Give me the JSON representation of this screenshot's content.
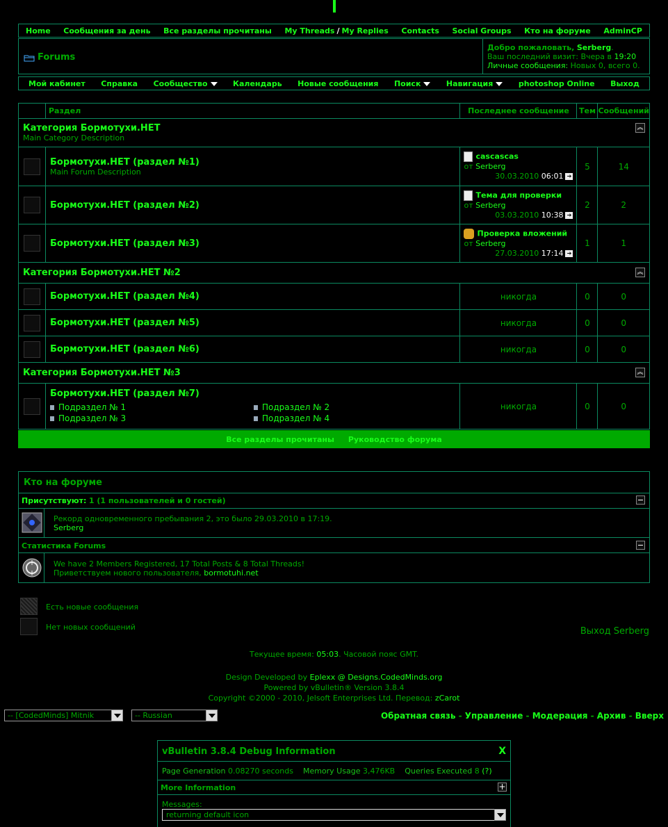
{
  "nav_top": {
    "home": "Home",
    "posts_today": "Сообщения за день",
    "mark_read": "Все разделы прочитаны",
    "my_threads": "My Threads",
    "slash": "/",
    "my_replies": "My Replies",
    "contacts": "Contacts",
    "social_groups": "Social Groups",
    "whos_online": "Кто на форуме",
    "admincp": "AdminCP"
  },
  "header": {
    "title": "Forums",
    "welcome": "Добро пожаловать,",
    "username": "Serberg",
    "period": ".",
    "last_visit_label": "Ваш последний визит:",
    "last_visit_value": "Вчера в",
    "last_visit_time": "19:20",
    "pm_label": "Личные сообщения:",
    "pm_value": "Новых 0, всего 0."
  },
  "nav_bottom": {
    "usercp": "Мой кабинет",
    "help": "Справка",
    "community": "Сообщество",
    "calendar": "Календарь",
    "new_posts": "Новые сообщения",
    "search": "Поиск",
    "navigation": "Навигация",
    "photoshop": "photoshop Online",
    "logout": "Выход"
  },
  "forum_table": {
    "col_forum": "Раздел",
    "col_last": "Последнее сообщение",
    "col_threads": "Тем",
    "col_posts": "Сообщений",
    "from": "от",
    "never": "никогда",
    "categories": [
      {
        "title": "Категория Бормотухи.НЕТ",
        "desc": "Main Category Description",
        "forums": [
          {
            "name": "Бормотухи.НЕТ (раздел №1)",
            "desc": "Main Forum Description",
            "last_title": "cascascas",
            "last_user": "Serberg",
            "last_date": "30.03.2010",
            "last_time": "06:01",
            "threads": "5",
            "posts": "14"
          },
          {
            "name": "Бормотухи.НЕТ (раздел №2)",
            "desc": "",
            "last_title": "Тема для проверки",
            "last_user": "Serberg",
            "last_date": "03.03.2010",
            "last_time": "10:38",
            "threads": "2",
            "posts": "2"
          },
          {
            "name": "Бормотухи.НЕТ (раздел №3)",
            "desc": "",
            "last_title": "Проверка вложений",
            "last_user": "Serberg",
            "last_date": "27.03.2010",
            "last_time": "17:14",
            "threads": "1",
            "posts": "1"
          }
        ]
      },
      {
        "title": "Категория Бормотухи.НЕТ №2",
        "forums": [
          {
            "name": "Бормотухи.НЕТ (раздел №4)",
            "threads": "0",
            "posts": "0"
          },
          {
            "name": "Бормотухи.НЕТ (раздел №5)",
            "threads": "0",
            "posts": "0"
          },
          {
            "name": "Бормотухи.НЕТ (раздел №6)",
            "threads": "0",
            "posts": "0"
          }
        ]
      },
      {
        "title": "Категория Бормотухи.НЕТ №3",
        "forums": [
          {
            "name": "Бормотухи.НЕТ (раздел №7)",
            "threads": "0",
            "posts": "0",
            "subforums": [
              "Подраздел № 1",
              "Подраздел № 2",
              "Подраздел № 3",
              "Подраздел № 4"
            ]
          }
        ]
      }
    ],
    "footer_mark_read": "Все разделы прочитаны",
    "footer_guide": "Руководство форума"
  },
  "whos_online": {
    "title": "Кто на форуме",
    "present_label": "Присутствуют:",
    "present_value": "1 (1 пользователей и 0 гостей)",
    "record": "Рекорд одновременного пребывания 2, это было 29.03.2010 в 17:19.",
    "online_user": "Serberg",
    "stats_title": "Статистика Forums",
    "stats_line": "We have 2 Members Registered, 17 Total Posts & 8 Total Threads!",
    "welcome_new": "Приветствуем нового пользователя,",
    "new_user": "bormotuhi.net"
  },
  "legend": {
    "new_posts": "Есть новые сообщения",
    "no_new_posts": "Нет новых сообщений",
    "logout": "Выход Serberg"
  },
  "footer": {
    "time_label": "Текущее время:",
    "time_value": "05:03",
    "tz": ". Часовой пояс GMT.",
    "design_label": "Design Developed by",
    "design_link": "Eplexx @ Designs.CodedMinds.org",
    "powered": "Powered by vBulletin® Version 3.8.4",
    "copyright": "Copyright ©2000 - 2010, Jelsoft Enterprises Ltd. Перевод:",
    "translator": "zCarot",
    "style_select": "-- [CodedMinds] Mitnik",
    "lang_select": "-- Russian",
    "links": {
      "feedback": "Обратная связь",
      "admin": "Управление",
      "mod": "Модерация",
      "archive": "Архив",
      "top": "Вверх",
      "dash": "-"
    }
  },
  "debug": {
    "title": "vBulletin 3.8.4 Debug Information",
    "close": "X",
    "page_gen_label": "Page Generation",
    "page_gen_value": "0.08270 seconds",
    "mem_label": "Memory Usage",
    "mem_value": "3,476KB",
    "queries_label": "Queries Executed",
    "queries_value": "8",
    "queries_help": "(?)",
    "more_info": "More Information",
    "messages_label": "Messages:",
    "messages_value": "returning default icon"
  },
  "colors": {
    "background": "#000000",
    "accent": "#19ff19",
    "text": "#00aa00",
    "border": "#0b8a60",
    "bar": "#00aa00"
  }
}
